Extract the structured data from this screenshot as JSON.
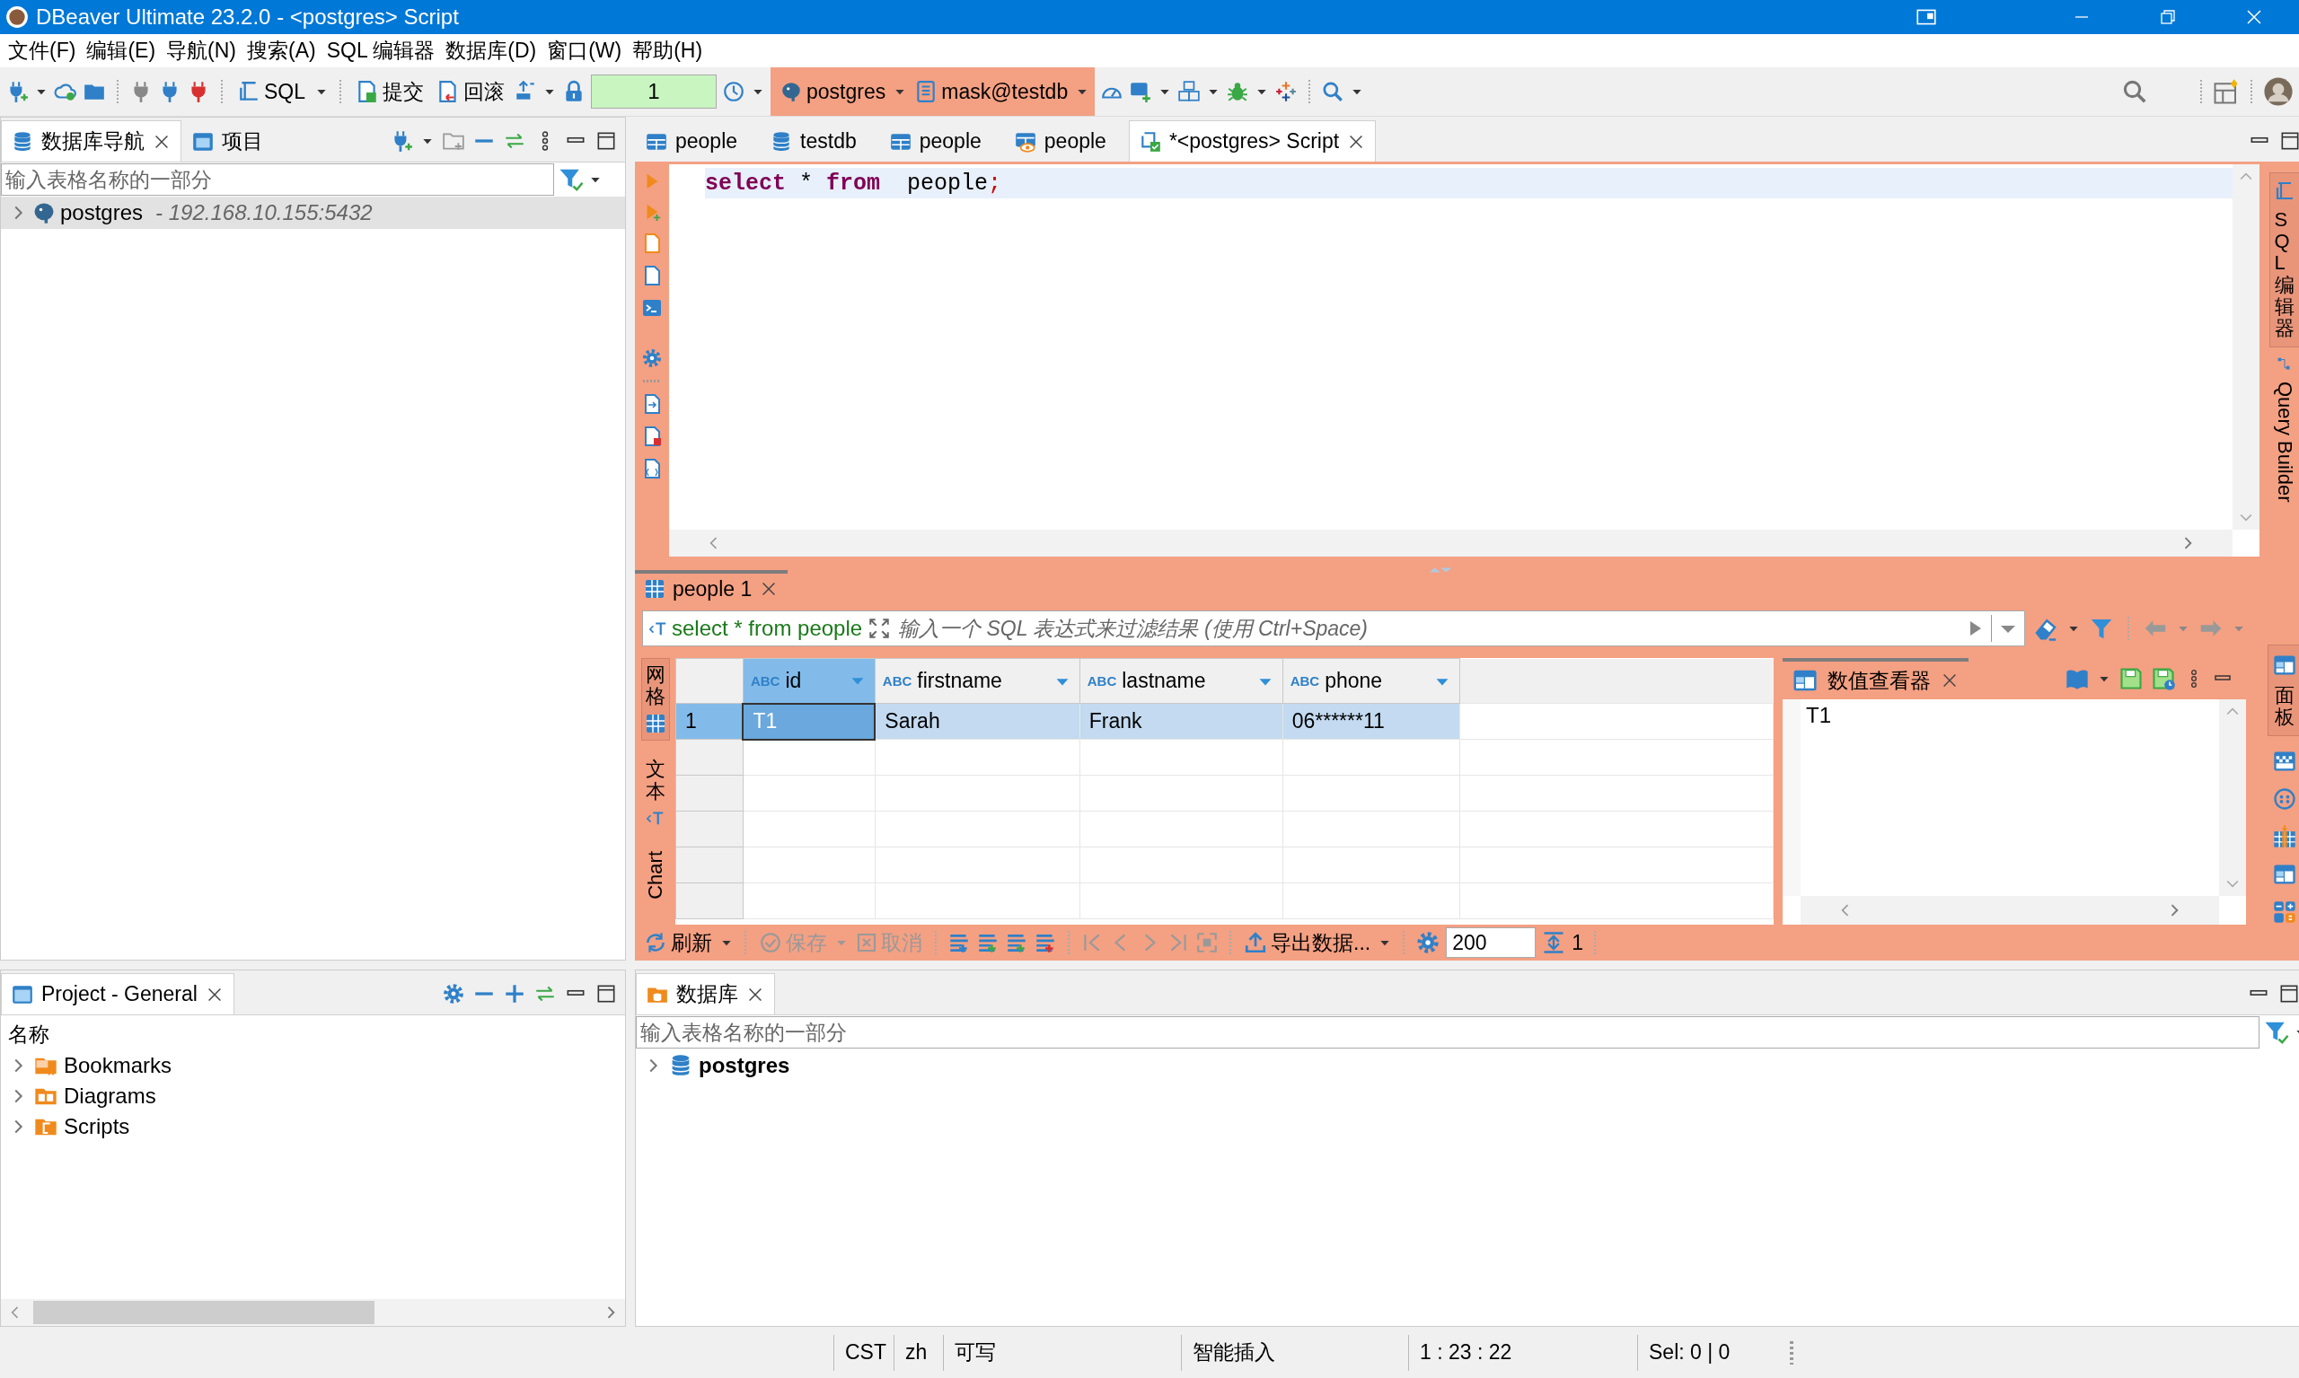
{
  "window": {
    "title": "DBeaver Ultimate 23.2.0 - <postgres> Script"
  },
  "menu": [
    "文件(F)",
    "编辑(E)",
    "导航(N)",
    "搜索(A)",
    "SQL 编辑器",
    "数据库(D)",
    "窗口(W)",
    "帮助(H)"
  ],
  "toolbar": {
    "sql": "SQL",
    "commit": "提交",
    "rollback": "回滚",
    "counter": "1",
    "datasource": "postgres",
    "schema": "mask@testdb"
  },
  "navigator": {
    "tabs": [
      {
        "label": "数据库导航",
        "selected": true
      },
      {
        "label": "项目",
        "selected": false
      }
    ],
    "filter_placeholder": "输入表格名称的一部分",
    "tree": [
      {
        "label": "postgres",
        "detail": "- 192.168.10.155:5432",
        "expanded": false,
        "selected": true
      }
    ]
  },
  "editor": {
    "tabs": [
      {
        "label": "people",
        "kind": "table",
        "selected": false
      },
      {
        "label": "testdb",
        "kind": "database",
        "selected": false
      },
      {
        "label": "people",
        "kind": "table",
        "selected": false
      },
      {
        "label": "people",
        "kind": "view",
        "selected": false
      },
      {
        "label": "*<postgres> Script",
        "kind": "script",
        "selected": true
      }
    ],
    "code": [
      {
        "text": "select",
        "kind": "keyword"
      },
      {
        "text": " * ",
        "kind": "plain"
      },
      {
        "text": "from",
        "kind": "keyword"
      },
      {
        "text": "  people",
        "kind": "plain"
      },
      {
        "text": ";",
        "kind": "punct"
      }
    ],
    "side_tabs": [
      {
        "label": "SQL 编辑器",
        "kind": "cjk",
        "selected": true
      },
      {
        "label": "Query Builder",
        "kind": "latin",
        "selected": false
      }
    ]
  },
  "results": {
    "tab": "people 1",
    "query": "select * from people",
    "filter_placeholder": "输入一个 SQL 表达式来过滤结果 (使用 Ctrl+Space)",
    "side_tabs": [
      {
        "label": "网格",
        "kind": "cjk",
        "selected": true
      },
      {
        "label": "文本",
        "kind": "cjk",
        "selected": false
      },
      {
        "label": "Chart",
        "kind": "latin",
        "selected": false
      }
    ],
    "columns": [
      {
        "type": "ABC",
        "name": "id",
        "selected": true
      },
      {
        "type": "ABC",
        "name": "firstname",
        "selected": false
      },
      {
        "type": "ABC",
        "name": "lastname",
        "selected": false
      },
      {
        "type": "ABC",
        "name": "phone",
        "selected": false
      }
    ],
    "rows": [
      {
        "number": "1",
        "cells": [
          "T1",
          "Sarah",
          "Frank",
          "06******11"
        ],
        "selected": true
      }
    ],
    "bottom_toolbar": {
      "refresh": {
        "label": "刷新",
        "disabled": false
      },
      "save": {
        "label": "保存",
        "disabled": true
      },
      "cancel": {
        "label": "取消",
        "disabled": true
      },
      "export": {
        "label": "导出数据...",
        "disabled": false
      },
      "fetch_size": "200",
      "row_count": "1"
    },
    "value_viewer": {
      "title": "数值查看器",
      "value": "T1"
    },
    "panel_tab": {
      "label": "面板",
      "selected": true
    }
  },
  "project": {
    "title": "Project - General",
    "column": "名称",
    "items": [
      {
        "label": "Bookmarks",
        "kind": "bookmarks"
      },
      {
        "label": "Diagrams",
        "kind": "diagrams"
      },
      {
        "label": "Scripts",
        "kind": "scripts"
      }
    ]
  },
  "database_panel": {
    "title": "数据库",
    "filter_placeholder": "输入表格名称的一部分",
    "tree": [
      {
        "label": "postgres",
        "expanded": false
      }
    ]
  },
  "status_bar": [
    "CST",
    "zh",
    "可写",
    "智能插入",
    "1 : 23 : 22",
    "Sel: 0 | 0"
  ]
}
